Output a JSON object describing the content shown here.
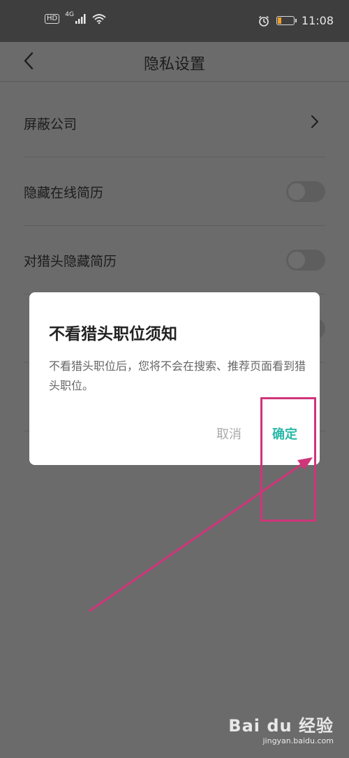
{
  "status_bar": {
    "hd": "HD",
    "network": "4G",
    "time": "11:08",
    "icons": [
      "signal-icon",
      "wifi-icon",
      "alarm-icon",
      "battery-icon"
    ],
    "battery_level_percent": 25
  },
  "header": {
    "title": "隐私设置",
    "back_icon": "chevron-left-icon"
  },
  "settings": [
    {
      "label": "屏蔽公司",
      "control": "chevron"
    },
    {
      "label": "隐藏在线简历",
      "control": "toggle",
      "on": false
    },
    {
      "label": "对猎头隐藏简历",
      "control": "toggle",
      "on": false
    }
  ],
  "dialog": {
    "title": "不看猎头职位须知",
    "body": "不看猎头职位后，您将不会在搜索、推荐页面看到猎头职位。",
    "cancel_label": "取消",
    "confirm_label": "确定"
  },
  "annotation": {
    "color": "#d0357a"
  },
  "watermark": {
    "logo": "Bai du 经验",
    "sub": "jingyan.baidu.com"
  },
  "colors": {
    "overlay": "#6b6b6b",
    "accent": "#2ab8a8",
    "status_bar": "#3e3e3e"
  }
}
